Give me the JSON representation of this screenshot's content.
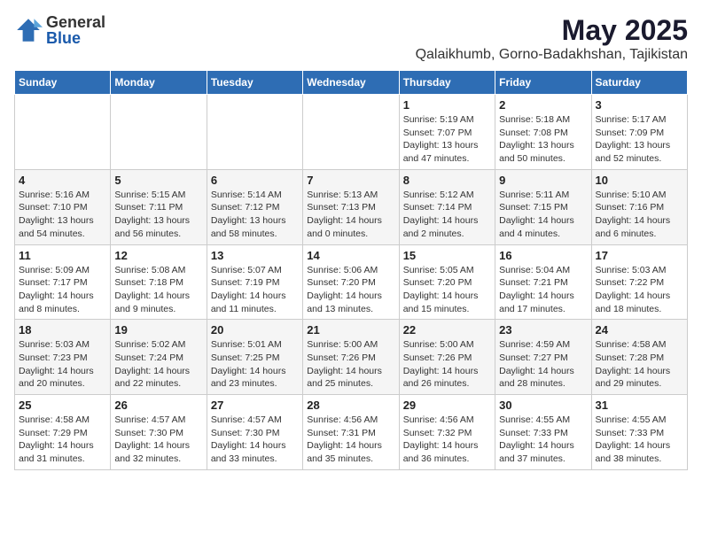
{
  "logo": {
    "general": "General",
    "blue": "Blue"
  },
  "title": "May 2025",
  "subtitle": "Qalaikhumb, Gorno-Badakhshan, Tajikistan",
  "days_of_week": [
    "Sunday",
    "Monday",
    "Tuesday",
    "Wednesday",
    "Thursday",
    "Friday",
    "Saturday"
  ],
  "weeks": [
    [
      {
        "day": "",
        "info": ""
      },
      {
        "day": "",
        "info": ""
      },
      {
        "day": "",
        "info": ""
      },
      {
        "day": "",
        "info": ""
      },
      {
        "day": "1",
        "info": "Sunrise: 5:19 AM\nSunset: 7:07 PM\nDaylight: 13 hours\nand 47 minutes."
      },
      {
        "day": "2",
        "info": "Sunrise: 5:18 AM\nSunset: 7:08 PM\nDaylight: 13 hours\nand 50 minutes."
      },
      {
        "day": "3",
        "info": "Sunrise: 5:17 AM\nSunset: 7:09 PM\nDaylight: 13 hours\nand 52 minutes."
      }
    ],
    [
      {
        "day": "4",
        "info": "Sunrise: 5:16 AM\nSunset: 7:10 PM\nDaylight: 13 hours\nand 54 minutes."
      },
      {
        "day": "5",
        "info": "Sunrise: 5:15 AM\nSunset: 7:11 PM\nDaylight: 13 hours\nand 56 minutes."
      },
      {
        "day": "6",
        "info": "Sunrise: 5:14 AM\nSunset: 7:12 PM\nDaylight: 13 hours\nand 58 minutes."
      },
      {
        "day": "7",
        "info": "Sunrise: 5:13 AM\nSunset: 7:13 PM\nDaylight: 14 hours\nand 0 minutes."
      },
      {
        "day": "8",
        "info": "Sunrise: 5:12 AM\nSunset: 7:14 PM\nDaylight: 14 hours\nand 2 minutes."
      },
      {
        "day": "9",
        "info": "Sunrise: 5:11 AM\nSunset: 7:15 PM\nDaylight: 14 hours\nand 4 minutes."
      },
      {
        "day": "10",
        "info": "Sunrise: 5:10 AM\nSunset: 7:16 PM\nDaylight: 14 hours\nand 6 minutes."
      }
    ],
    [
      {
        "day": "11",
        "info": "Sunrise: 5:09 AM\nSunset: 7:17 PM\nDaylight: 14 hours\nand 8 minutes."
      },
      {
        "day": "12",
        "info": "Sunrise: 5:08 AM\nSunset: 7:18 PM\nDaylight: 14 hours\nand 9 minutes."
      },
      {
        "day": "13",
        "info": "Sunrise: 5:07 AM\nSunset: 7:19 PM\nDaylight: 14 hours\nand 11 minutes."
      },
      {
        "day": "14",
        "info": "Sunrise: 5:06 AM\nSunset: 7:20 PM\nDaylight: 14 hours\nand 13 minutes."
      },
      {
        "day": "15",
        "info": "Sunrise: 5:05 AM\nSunset: 7:20 PM\nDaylight: 14 hours\nand 15 minutes."
      },
      {
        "day": "16",
        "info": "Sunrise: 5:04 AM\nSunset: 7:21 PM\nDaylight: 14 hours\nand 17 minutes."
      },
      {
        "day": "17",
        "info": "Sunrise: 5:03 AM\nSunset: 7:22 PM\nDaylight: 14 hours\nand 18 minutes."
      }
    ],
    [
      {
        "day": "18",
        "info": "Sunrise: 5:03 AM\nSunset: 7:23 PM\nDaylight: 14 hours\nand 20 minutes."
      },
      {
        "day": "19",
        "info": "Sunrise: 5:02 AM\nSunset: 7:24 PM\nDaylight: 14 hours\nand 22 minutes."
      },
      {
        "day": "20",
        "info": "Sunrise: 5:01 AM\nSunset: 7:25 PM\nDaylight: 14 hours\nand 23 minutes."
      },
      {
        "day": "21",
        "info": "Sunrise: 5:00 AM\nSunset: 7:26 PM\nDaylight: 14 hours\nand 25 minutes."
      },
      {
        "day": "22",
        "info": "Sunrise: 5:00 AM\nSunset: 7:26 PM\nDaylight: 14 hours\nand 26 minutes."
      },
      {
        "day": "23",
        "info": "Sunrise: 4:59 AM\nSunset: 7:27 PM\nDaylight: 14 hours\nand 28 minutes."
      },
      {
        "day": "24",
        "info": "Sunrise: 4:58 AM\nSunset: 7:28 PM\nDaylight: 14 hours\nand 29 minutes."
      }
    ],
    [
      {
        "day": "25",
        "info": "Sunrise: 4:58 AM\nSunset: 7:29 PM\nDaylight: 14 hours\nand 31 minutes."
      },
      {
        "day": "26",
        "info": "Sunrise: 4:57 AM\nSunset: 7:30 PM\nDaylight: 14 hours\nand 32 minutes."
      },
      {
        "day": "27",
        "info": "Sunrise: 4:57 AM\nSunset: 7:30 PM\nDaylight: 14 hours\nand 33 minutes."
      },
      {
        "day": "28",
        "info": "Sunrise: 4:56 AM\nSunset: 7:31 PM\nDaylight: 14 hours\nand 35 minutes."
      },
      {
        "day": "29",
        "info": "Sunrise: 4:56 AM\nSunset: 7:32 PM\nDaylight: 14 hours\nand 36 minutes."
      },
      {
        "day": "30",
        "info": "Sunrise: 4:55 AM\nSunset: 7:33 PM\nDaylight: 14 hours\nand 37 minutes."
      },
      {
        "day": "31",
        "info": "Sunrise: 4:55 AM\nSunset: 7:33 PM\nDaylight: 14 hours\nand 38 minutes."
      }
    ]
  ]
}
